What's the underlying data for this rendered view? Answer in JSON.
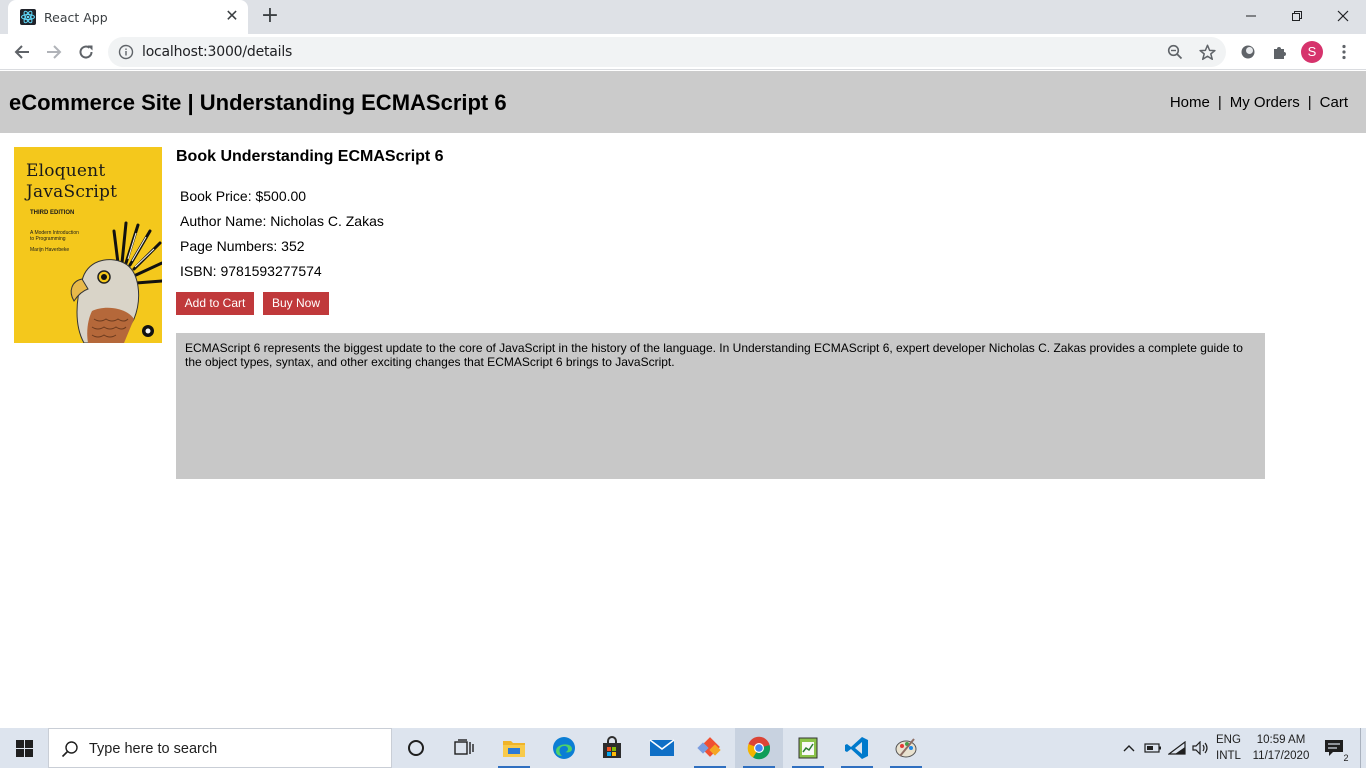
{
  "browser": {
    "tab_title": "React App",
    "url": "localhost:3000/details",
    "profile_initial": "S"
  },
  "site": {
    "title": "eCommerce Site | Understanding ECMAScript 6",
    "nav": [
      "Home",
      "My Orders",
      "Cart"
    ],
    "nav_separator": "|"
  },
  "book": {
    "cover": {
      "title_line1": "Eloquent",
      "title_line2": "JavaScript",
      "edition": "THIRD EDITION",
      "subtitle_line1": "A Modern Introduction",
      "subtitle_line2": "to Programming",
      "author": "Marijn Haverbeke",
      "background_color": "#f4c81c"
    },
    "heading": "Book Understanding ECMAScript 6",
    "price": "Book Price: $500.00",
    "author": "Author Name: Nicholas C. Zakas",
    "pages": "Page Numbers: 352",
    "isbn": "ISBN: 9781593277574",
    "add_to_cart": "Add to Cart",
    "buy_now": "Buy Now",
    "description": "ECMAScript 6 represents the biggest update to the core of JavaScript in the history of the language. In Understanding ECMAScript 6, expert developer Nicholas C. Zakas provides a complete guide to the object types, syntax, and other exciting changes that ECMAScript 6 brings to JavaScript."
  },
  "taskbar": {
    "search_placeholder": "Type here to search",
    "language_line1": "ENG",
    "language_line2": "INTL",
    "time": "10:59 AM",
    "date": "11/17/2020",
    "notification_count": "2",
    "apps": [
      "cortana-icon",
      "task-view-icon",
      "file-explorer-icon",
      "edge-icon",
      "store-icon",
      "mail-icon",
      "git-icon",
      "chrome-icon",
      "notepad-icon",
      "vscode-icon",
      "paint-icon"
    ]
  },
  "colors": {
    "header_bg": "#cbcbcb",
    "button_bg": "#c0393b",
    "description_bg": "#c8c8c8"
  }
}
